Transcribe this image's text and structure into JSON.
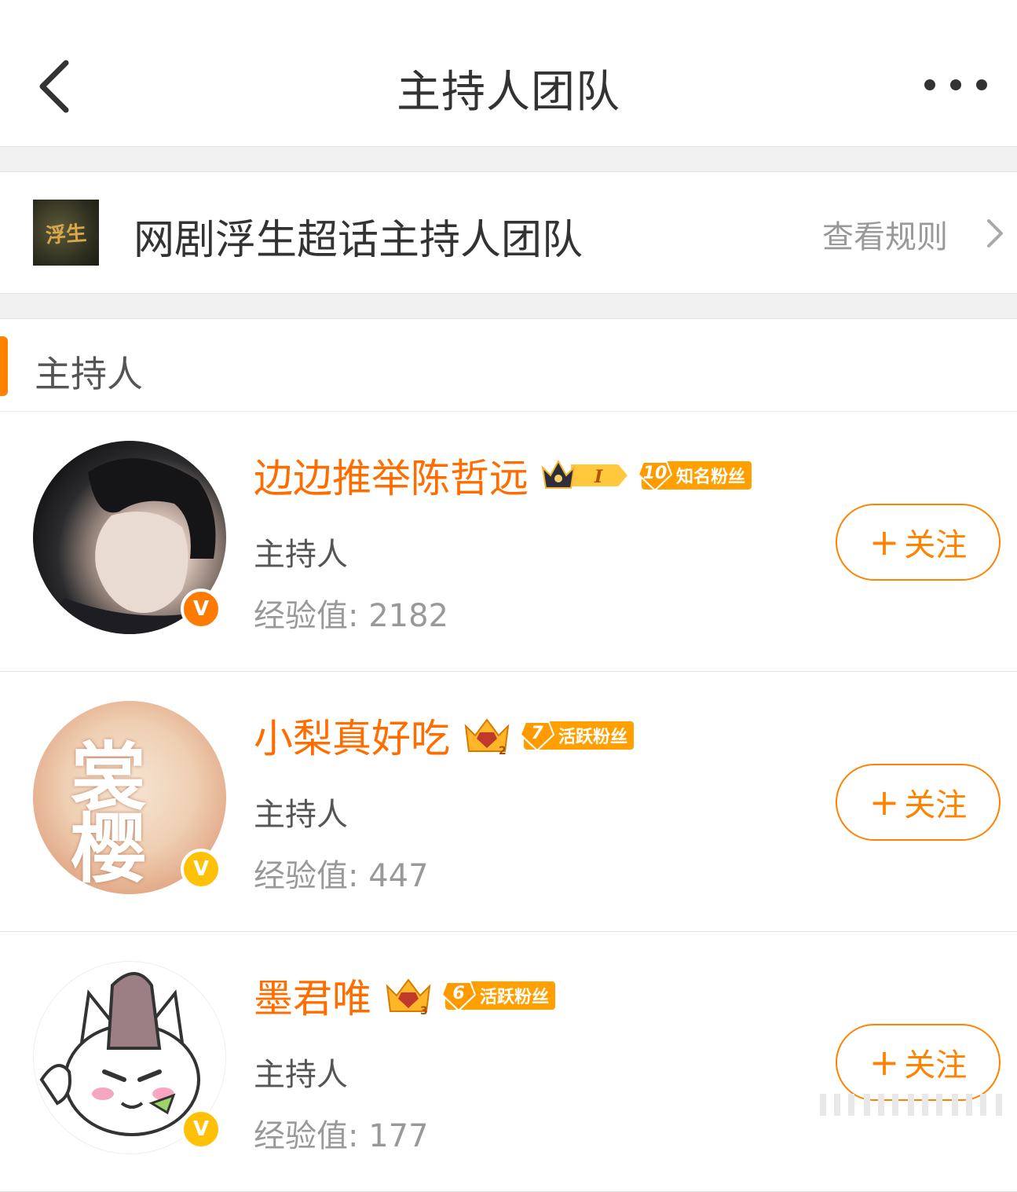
{
  "nav": {
    "title": "主持人团队"
  },
  "team": {
    "cover_text": "浮生",
    "name": "网剧浮生超话主持人团队",
    "rules_label": "查看规则"
  },
  "section": {
    "title": "主持人"
  },
  "hosts": [
    {
      "name": "边边推举陈哲远",
      "role": "主持人",
      "exp": "经验值: 2182",
      "fan_level": "10",
      "fan_title": "知名粉丝",
      "follow_label": "关注",
      "verify_color": "#ff7a00"
    },
    {
      "name": "小梨真好吃",
      "role": "主持人",
      "exp": "经验值: 447",
      "fan_level": "7",
      "fan_title": "活跃粉丝",
      "follow_label": "关注",
      "avatar_text": "裳樱",
      "verify_color": "#ffc107"
    },
    {
      "name": "墨君唯",
      "role": "主持人",
      "exp": "经验值: 177",
      "fan_level": "6",
      "fan_title": "活跃粉丝",
      "follow_label": "关注",
      "verify_color": "#ffc107"
    }
  ],
  "colors": {
    "accent": "#ff8200",
    "name": "#ff6d00",
    "fan_badge": "#ffa000"
  },
  "icons": [
    "back-arrow-icon",
    "more-dots-icon",
    "chevron-right-icon",
    "crown-icon",
    "verified-v-icon"
  ]
}
